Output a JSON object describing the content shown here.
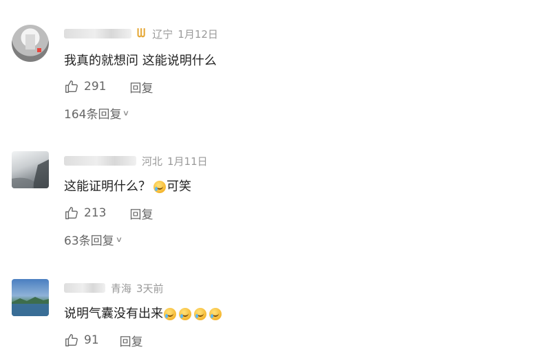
{
  "comments": [
    {
      "location": "辽宁",
      "date": "1月12日",
      "text": "我真的就想问 这能说明什么",
      "emojis": 0,
      "likes": "291",
      "reply_label": "回复",
      "more_replies": "164条回复"
    },
    {
      "location": "河北",
      "date": "1月11日",
      "text": "这能证明什么？",
      "text_after": "可笑",
      "emojis": 1,
      "likes": "213",
      "reply_label": "回复",
      "more_replies": "63条回复"
    },
    {
      "location": "青海",
      "date": "3天前",
      "text": "说明气囊没有出来",
      "emojis": 4,
      "likes": "91",
      "reply_label": "回复"
    }
  ],
  "icons": {
    "badge": "vip-badge-icon",
    "like": "thumbs-up-icon",
    "chevron": "chevron-down-icon",
    "emoji": "laugh-cry-emoji-icon"
  },
  "colors": {
    "meta_gray": "#999999",
    "badge_gold": "#e5a93a"
  }
}
